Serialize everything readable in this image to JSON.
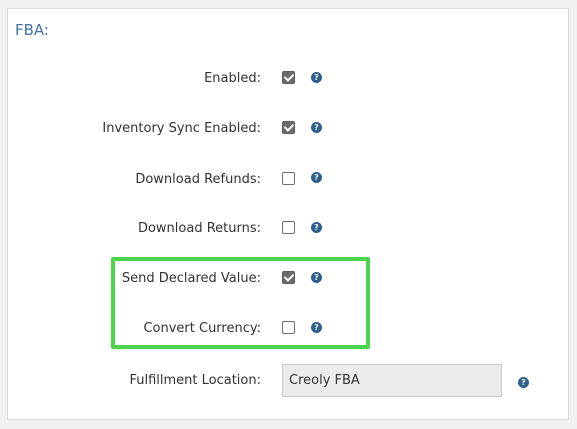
{
  "section": {
    "title": "FBA:"
  },
  "rows": [
    {
      "label": "Enabled:",
      "checked": true
    },
    {
      "label": "Inventory Sync Enabled:",
      "checked": true
    },
    {
      "label": "Download Refunds:",
      "checked": false
    },
    {
      "label": "Download Returns:",
      "checked": false
    },
    {
      "label": "Send Declared Value:",
      "checked": true
    },
    {
      "label": "Convert Currency:",
      "checked": false
    }
  ],
  "fulfillment": {
    "label": "Fulfillment Location:",
    "value": "Creoly FBA"
  },
  "help_icon_glyph": "?",
  "colors": {
    "accent": "#3f74a8",
    "highlight": "#4cd44c",
    "help_icon": "#2f5f8f"
  }
}
